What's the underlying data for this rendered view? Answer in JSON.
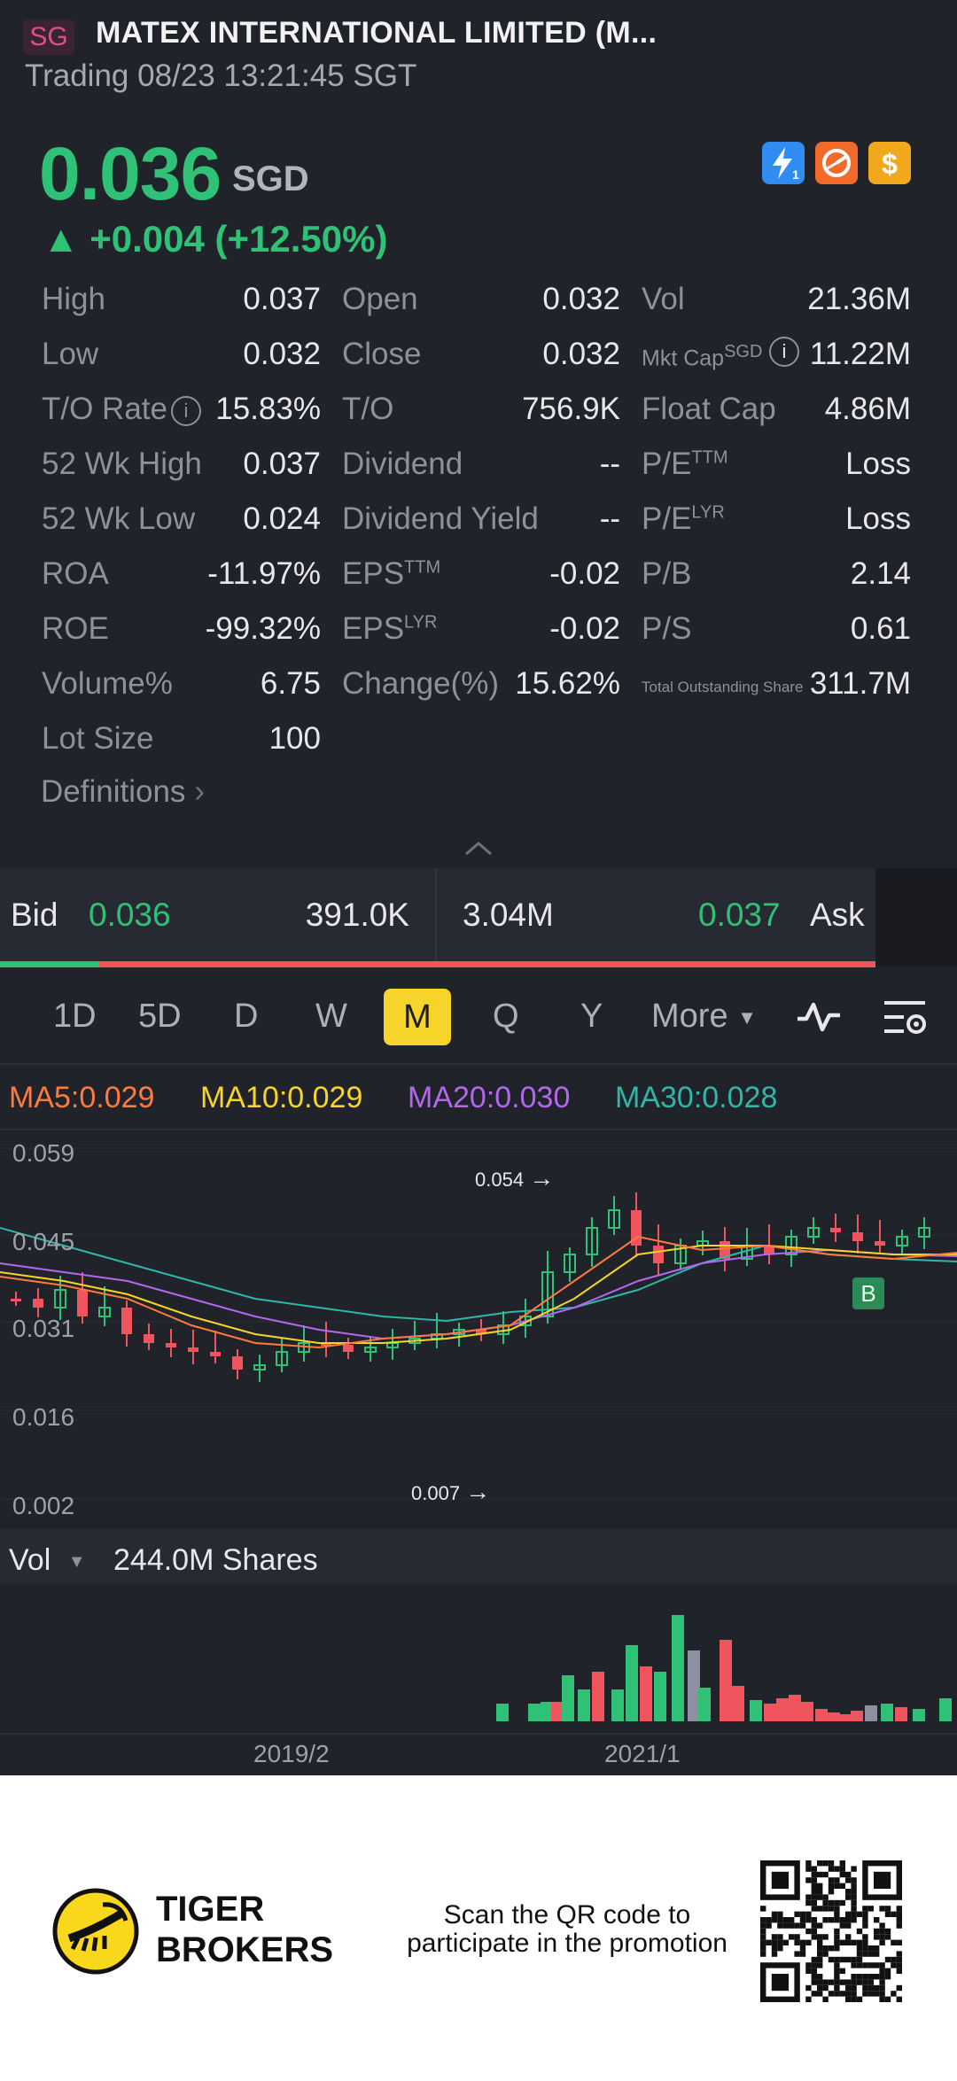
{
  "header": {
    "market_badge": "SG",
    "title": "MATEX INTERNATIONAL LIMITED (M...",
    "status": "Trading 08/23 13:21:45 SGT"
  },
  "quote": {
    "price": "0.036",
    "currency": "SGD",
    "change": "▲ +0.004 (+12.50%)",
    "icons": [
      "lightning-icon",
      "pie-icon",
      "dollar-icon"
    ],
    "icon_colors": [
      "#2f8df2",
      "#f26a2a",
      "#f2a81c"
    ],
    "up_color": "#2fc277",
    "down_color": "#f0545d"
  },
  "stats": {
    "high_l": "High",
    "high_v": "0.037",
    "open_l": "Open",
    "open_v": "0.032",
    "vol_l": "Vol",
    "vol_v": "21.36M",
    "low_l": "Low",
    "low_v": "0.032",
    "close_l": "Close",
    "close_v": "0.032",
    "mktcap_l": "Mkt Cap",
    "mktcap_sup": "SGD",
    "mktcap_v": "11.22M",
    "torate_l": "T/O Rate",
    "torate_v": "15.83%",
    "to_l": "T/O",
    "to_v": "756.9K",
    "float_l": "Float Cap",
    "float_v": "4.86M",
    "wkhigh_l": "52 Wk High",
    "wkhigh_v": "0.037",
    "div_l": "Dividend",
    "div_v": "--",
    "pettm_l": "P/E",
    "pettm_sup": "TTM",
    "pettm_v": "Loss",
    "wklow_l": "52 Wk Low",
    "wklow_v": "0.024",
    "divy_l": "Dividend Yield",
    "divy_v": "--",
    "pelyr_l": "P/E",
    "pelyr_sup": "LYR",
    "pelyr_v": "Loss",
    "roa_l": "ROA",
    "roa_v": "-11.97%",
    "epsttm_l": "EPS",
    "epsttm_sup": "TTM",
    "epsttm_v": "-0.02",
    "pb_l": "P/B",
    "pb_v": "2.14",
    "roe_l": "ROE",
    "roe_v": "-99.32%",
    "epslyr_l": "EPS",
    "epslyr_sup": "LYR",
    "epslyr_v": "-0.02",
    "ps_l": "P/S",
    "ps_v": "0.61",
    "volpct_l": "Volume%",
    "volpct_v": "6.75",
    "chgpct_l": "Change(%)",
    "chgpct_v": "15.62%",
    "tos_l": "Total Outstanding Share",
    "tos_v": "311.7M",
    "lot_l": "Lot Size",
    "lot_v": "100",
    "definitions": "Definitions"
  },
  "orderbook": {
    "bid_label": "Bid",
    "bid_price": "0.036",
    "bid_size": "391.0K",
    "ask_size": "3.04M",
    "ask_price": "0.037",
    "ask_label": "Ask",
    "bid_ratio": 0.113
  },
  "timeframes": [
    "1D",
    "5D",
    "D",
    "W",
    "M",
    "Q",
    "Y",
    "More"
  ],
  "active_timeframe": "M",
  "ma": {
    "ma5": "MA5:0.029",
    "ma10": "MA10:0.029",
    "ma20": "MA20:0.030",
    "ma30": "MA30:0.028",
    "colors": {
      "ma5": "#ff7a3c",
      "ma10": "#f6d429",
      "ma20": "#b367ee",
      "ma30": "#2fb6a6"
    }
  },
  "chart_data": [
    {
      "type": "candlestick",
      "title": "",
      "y_ticks": [
        "0.059",
        "0.045",
        "0.031",
        "0.016",
        "0.002"
      ],
      "ylim": [
        0.002,
        0.059
      ],
      "max_marker": "0.054",
      "min_marker": "0.007",
      "signal_marker": "B",
      "x_ticks": [
        "2019/2",
        "2021/1"
      ]
    },
    {
      "type": "bar",
      "title": "",
      "label": "Vol",
      "value_label": "244.0M Shares",
      "x_ticks": [
        "2019/2",
        "2021/1"
      ]
    }
  ],
  "footer": {
    "brand_line1": "TIGER",
    "brand_line2": "BROKERS",
    "promo_line1": "Scan the QR code to",
    "promo_line2": "participate in the promotion"
  }
}
